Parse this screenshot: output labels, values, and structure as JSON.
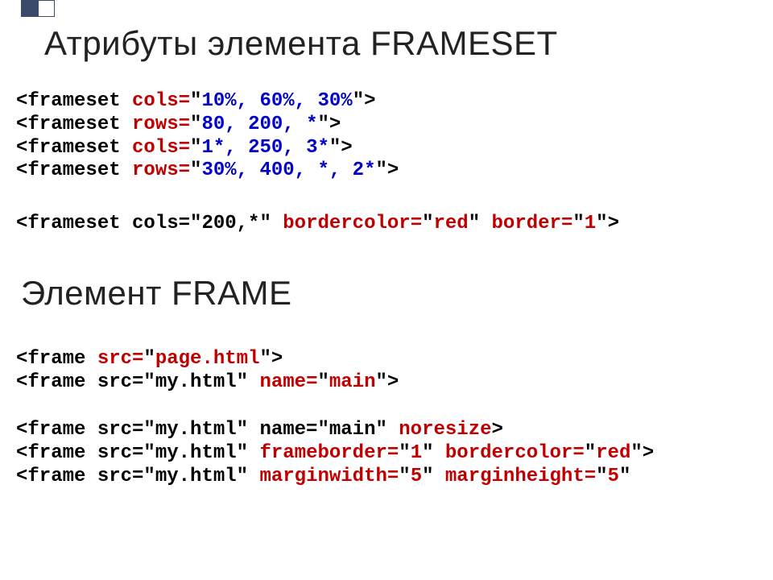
{
  "bullets": {
    "filled": true,
    "empty": true
  },
  "heading1": "Атрибуты элемента FRAMESET",
  "heading2": "Элемент FRAME",
  "code1": {
    "l1": {
      "a": "<frameset ",
      "b": "cols=",
      "c": "\"",
      "d": "10%, 60%, 30%",
      "e": "\">"
    },
    "l2": {
      "a": "<frameset ",
      "b": "rows=",
      "c": "\"",
      "d": "80, 200, *",
      "e": "\">"
    },
    "l3": {
      "a": "<frameset ",
      "b": "cols=",
      "c": "\"",
      "d": "1*, 250, 3*",
      "e": "\">"
    },
    "l4": {
      "a": "<frameset ",
      "b": "rows=",
      "c": "\"",
      "d": "30%, 400, *, 2*",
      "e": "\">"
    }
  },
  "code2": {
    "l1": {
      "a": "<frameset cols=\"200,*\" ",
      "b": "bordercolor=",
      "c": "\"",
      "d": "red",
      "e": "\" ",
      "f": "border=",
      "g": "\"",
      "h": "1",
      "i": "\">"
    }
  },
  "code3": {
    "l1": {
      "a": "<frame ",
      "b": "src=",
      "c": "\"",
      "d": "page.html",
      "e": "\">"
    },
    "l2": {
      "a": "<frame src=\"my.html\" ",
      "b": "name=",
      "c": "\"",
      "d": "main",
      "e": "\">"
    }
  },
  "code4": {
    "l1": {
      "a": "<frame src=\"my.html\" name=\"main\" ",
      "b": "noresize",
      "c": ">"
    },
    "l2": {
      "a": "<frame src=\"my.html\" ",
      "b": "frameborder=",
      "c": "\"",
      "d": "1",
      "e": "\" ",
      "f": "bordercolor=",
      "g": "\"",
      "h": "red",
      "i": "\">"
    },
    "l3": {
      "a": "<frame src=\"my.html\" ",
      "b": "marginwidth=",
      "c": "\"",
      "d": "5",
      "e": "\" ",
      "f": "marginheight=",
      "g": "\"",
      "h": "5",
      "i": "\""
    }
  }
}
